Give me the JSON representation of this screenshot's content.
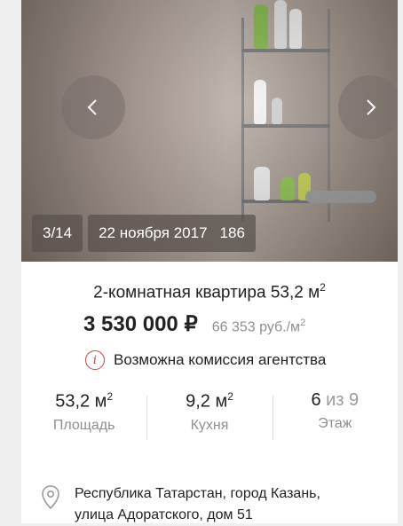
{
  "gallery": {
    "counter": "3/14",
    "date": "22 ноября 2017",
    "views": "186"
  },
  "listing": {
    "title": "2-комнатная квартира 53,2 м",
    "title_sup": "2",
    "price": "3 530 000 ₽",
    "price_per_m2": "66 353 руб./м",
    "price_per_m2_sup": "2",
    "commission": "Возможна комиссия агентства"
  },
  "stats": [
    {
      "value": "53,2 м",
      "sup": "2",
      "label": "Площадь"
    },
    {
      "value": "9,2 м",
      "sup": "2",
      "label": "Кухня"
    },
    {
      "value_main": "6",
      "value_muted": "из 9",
      "label": "Этаж"
    }
  ],
  "address": {
    "line1": "Республика Татарстан, город Казань,",
    "line2": "улица Адоратского, дом 51"
  },
  "icons": {
    "prev": "chevron-left-icon",
    "next": "chevron-right-icon",
    "info": "info-icon",
    "location": "location-pin-icon"
  },
  "colors": {
    "accent_red": "#c8423b",
    "muted_text": "#8f8f8f"
  }
}
